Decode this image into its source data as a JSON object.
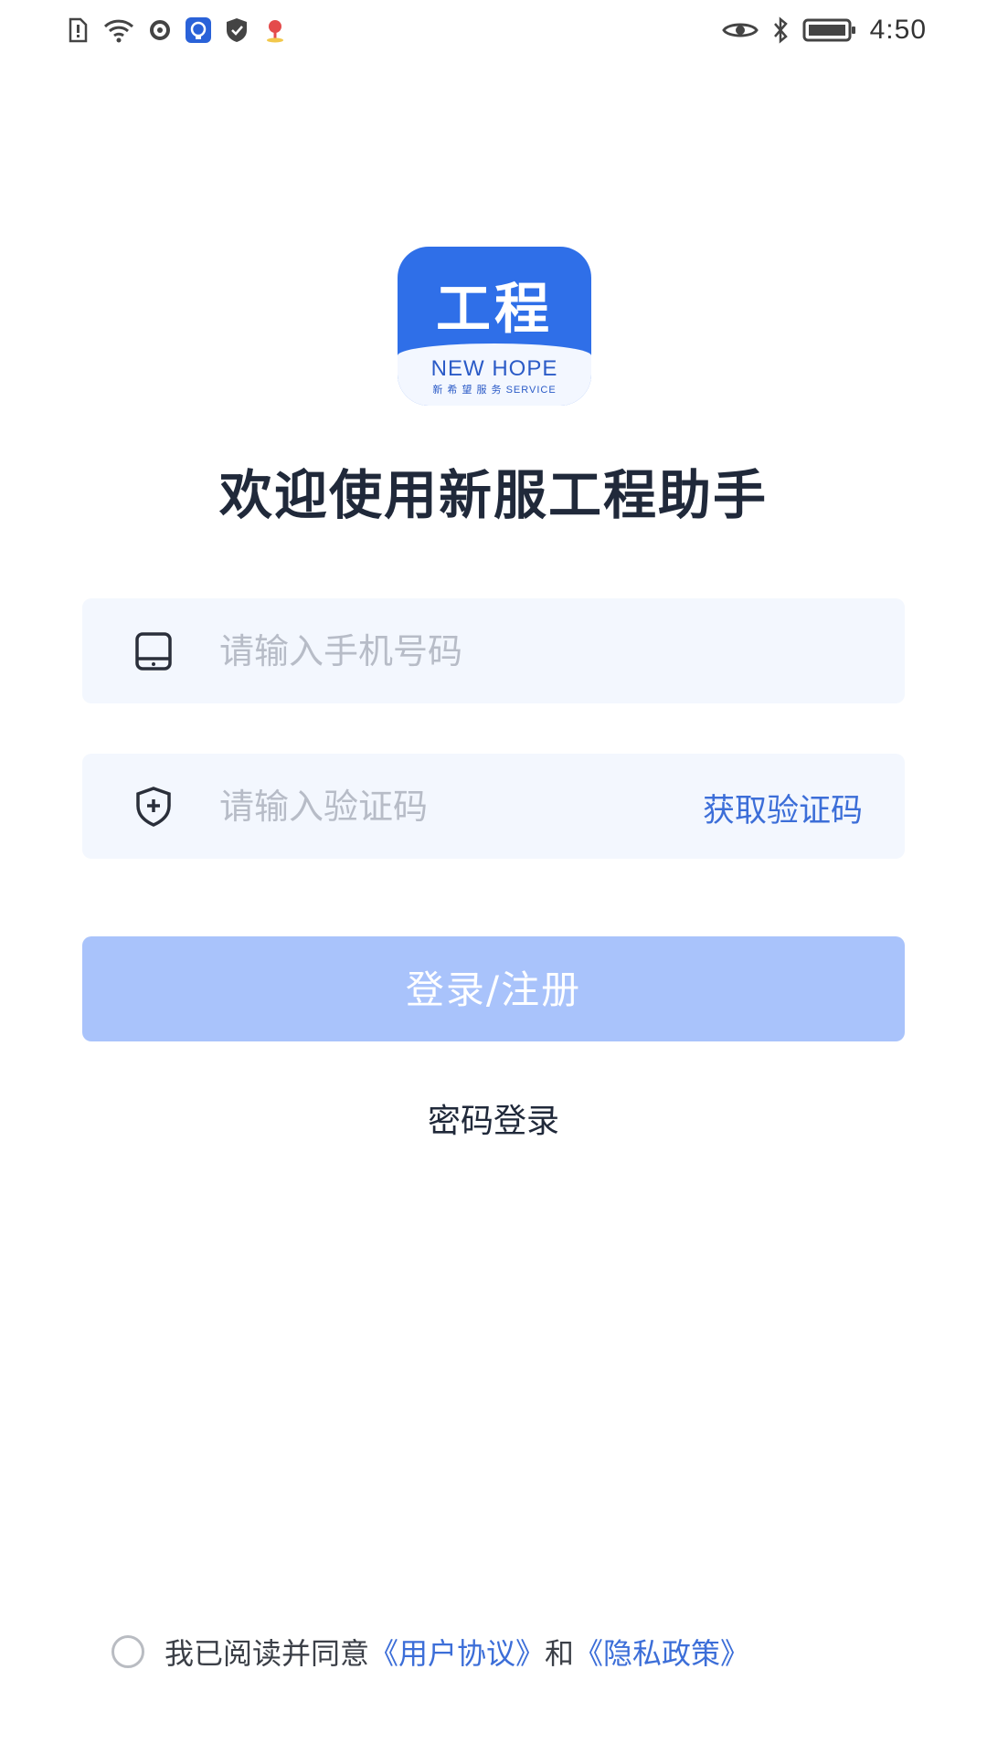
{
  "status_bar": {
    "time": "4:50",
    "left_icons": [
      "sim-alert-icon",
      "wifi-icon",
      "sync-icon",
      "security-app-icon",
      "shield-check-icon",
      "location-app-icon"
    ],
    "right_icons": [
      "eye-icon",
      "bluetooth-icon",
      "battery-icon"
    ]
  },
  "logo": {
    "title": "工程",
    "brand": "NEW HOPE",
    "sub": "新 希 望 服 务 SERVICE"
  },
  "welcome_title": "欢迎使用新服工程助手",
  "phone_field": {
    "placeholder": "请输入手机号码",
    "icon": "phone-icon"
  },
  "code_field": {
    "placeholder": "请输入验证码",
    "icon": "shield-plus-icon",
    "get_code_label": "获取验证码"
  },
  "login_button": "登录/注册",
  "password_login": "密码登录",
  "agreement": {
    "prefix": "我已阅读并同意",
    "user_agreement": "《用户协议》",
    "and": "和",
    "privacy_policy": "《隐私政策》"
  },
  "colors": {
    "accent": "#3c6ed8",
    "button_disabled": "#a9c3fb",
    "field_bg": "#f3f7fe",
    "logo_blue": "#2f6fe8"
  }
}
